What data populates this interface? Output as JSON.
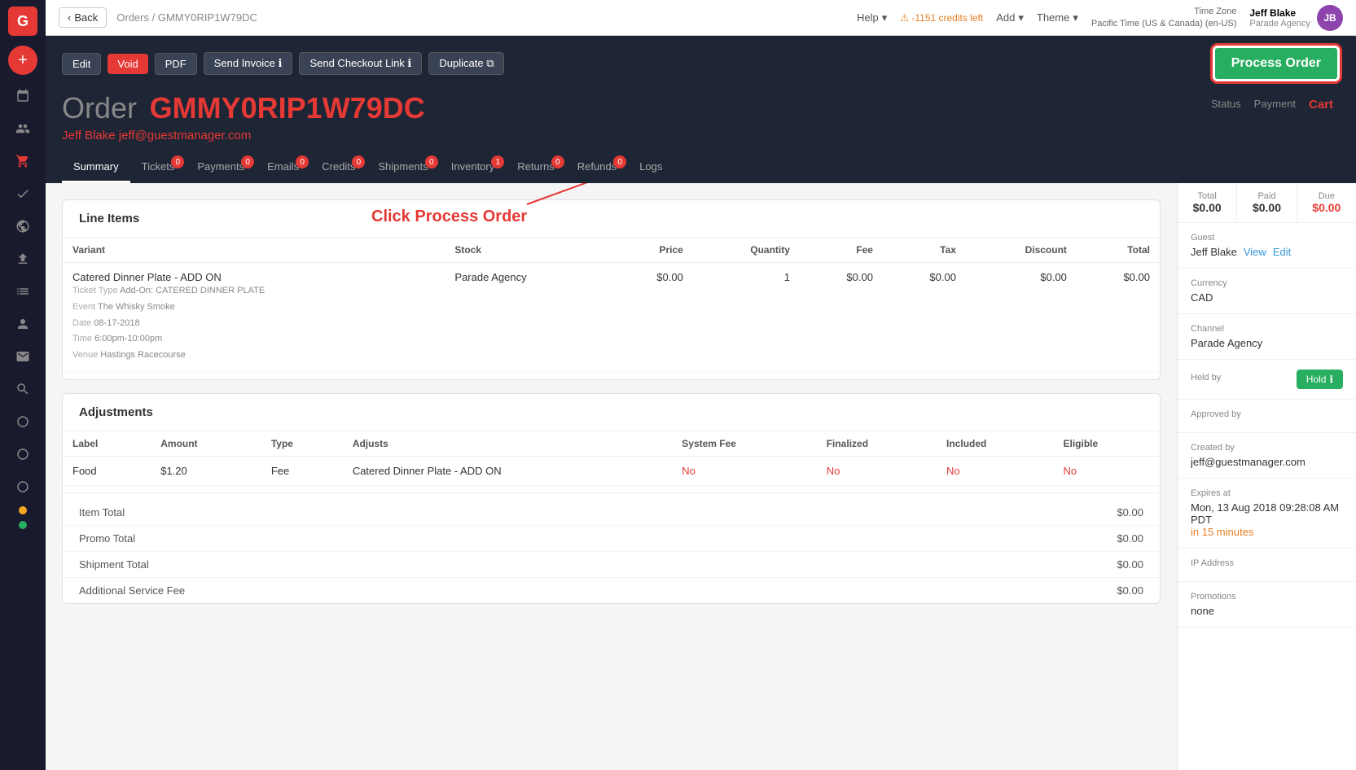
{
  "app": {
    "logo": "G"
  },
  "topnav": {
    "back_label": "Back",
    "breadcrumb_orders": "Orders",
    "breadcrumb_separator": "/",
    "breadcrumb_current": "GMMY0RIP1W79DC",
    "help_label": "Help",
    "credits_label": "⚠ -1151 credits left",
    "add_label": "Add",
    "theme_label": "Theme",
    "timezone_label": "Time Zone",
    "timezone_value": "Pacific Time (US & Canada) (en-US)",
    "user_name": "Jeff Blake",
    "user_agency": "Parade Agency",
    "user_initials": "JB"
  },
  "order": {
    "prefix": "Order",
    "id": "GMMY0RIP1W79DC",
    "customer_name": "Jeff Blake",
    "customer_email": "jeff@guestmanager.com",
    "action_buttons": {
      "edit": "Edit",
      "void": "Void",
      "pdf": "PDF",
      "send_invoice": "Send Invoice",
      "send_checkout_link": "Send Checkout Link",
      "duplicate": "Duplicate",
      "process_order": "Process Order"
    },
    "tabs": [
      {
        "label": "Summary",
        "badge": null,
        "active": true
      },
      {
        "label": "Tickets",
        "badge": "0",
        "active": false
      },
      {
        "label": "Payments",
        "badge": "0",
        "active": false
      },
      {
        "label": "Emails",
        "badge": "0",
        "active": false
      },
      {
        "label": "Credits",
        "badge": "0",
        "active": false
      },
      {
        "label": "Shipments",
        "badge": "0",
        "active": false
      },
      {
        "label": "Inventory",
        "badge": "1",
        "active": false
      },
      {
        "label": "Returns",
        "badge": "0",
        "active": false
      },
      {
        "label": "Refunds",
        "badge": "0",
        "active": false
      },
      {
        "label": "Logs",
        "badge": null,
        "active": false
      }
    ],
    "status_tabs": [
      {
        "label": "Status",
        "active": false
      },
      {
        "label": "Payment",
        "active": false
      }
    ],
    "cart_status": "Cart"
  },
  "right_sidebar": {
    "total_label": "Total",
    "total_value": "$0.00",
    "paid_label": "Paid",
    "paid_value": "$0.00",
    "due_label": "Due",
    "due_value": "$0.00",
    "guest_label": "Guest",
    "guest_name": "Jeff Blake",
    "guest_view": "View",
    "guest_edit": "Edit",
    "currency_label": "Currency",
    "currency_value": "CAD",
    "channel_label": "Channel",
    "channel_value": "Parade Agency",
    "held_by_label": "Held by",
    "hold_button": "Hold",
    "hold_icon": "ℹ",
    "approved_by_label": "Approved by",
    "created_by_label": "Created by",
    "created_by_value": "jeff@guestmanager.com",
    "expires_at_label": "Expires at",
    "expires_at_value": "Mon, 13 Aug 2018 09:28:08 AM PDT",
    "expires_in": "in 15 minutes",
    "ip_address_label": "IP Address",
    "ip_address_value": "",
    "promotions_label": "Promotions",
    "promotions_value": "none"
  },
  "line_items": {
    "section_title": "Line Items",
    "columns": [
      "Variant",
      "Stock",
      "Price",
      "Quantity",
      "Fee",
      "Tax",
      "Discount",
      "Total"
    ],
    "rows": [
      {
        "variant": "Catered Dinner Plate - ADD ON",
        "ticket_type": "Add-On: CATERED DINNER PLATE",
        "event": "The Whisky Smoke",
        "date": "08-17-2018",
        "time": "6:00pm-10:00pm",
        "venue": "Hastings Racecourse",
        "stock": "Parade Agency",
        "price": "$0.00",
        "quantity": "1",
        "fee": "$0.00",
        "tax": "$0.00",
        "discount": "$0.00",
        "total": "$0.00"
      }
    ]
  },
  "adjustments": {
    "section_title": "Adjustments",
    "columns": [
      "Label",
      "Amount",
      "Type",
      "Adjusts",
      "System Fee",
      "Finalized",
      "Included",
      "Eligible"
    ],
    "rows": [
      {
        "label": "Food",
        "amount": "$1.20",
        "type": "Fee",
        "adjusts": "Catered Dinner Plate - ADD ON",
        "system_fee": "No",
        "finalized": "No",
        "included": "No",
        "eligible": "No"
      }
    ]
  },
  "totals": [
    {
      "label": "Item Total",
      "value": "$0.00"
    },
    {
      "label": "Promo Total",
      "value": "$0.00"
    },
    {
      "label": "Shipment Total",
      "value": "$0.00"
    },
    {
      "label": "Additional Service Fee",
      "value": "$0.00"
    }
  ],
  "annotation": {
    "text": "Click Process Order"
  }
}
